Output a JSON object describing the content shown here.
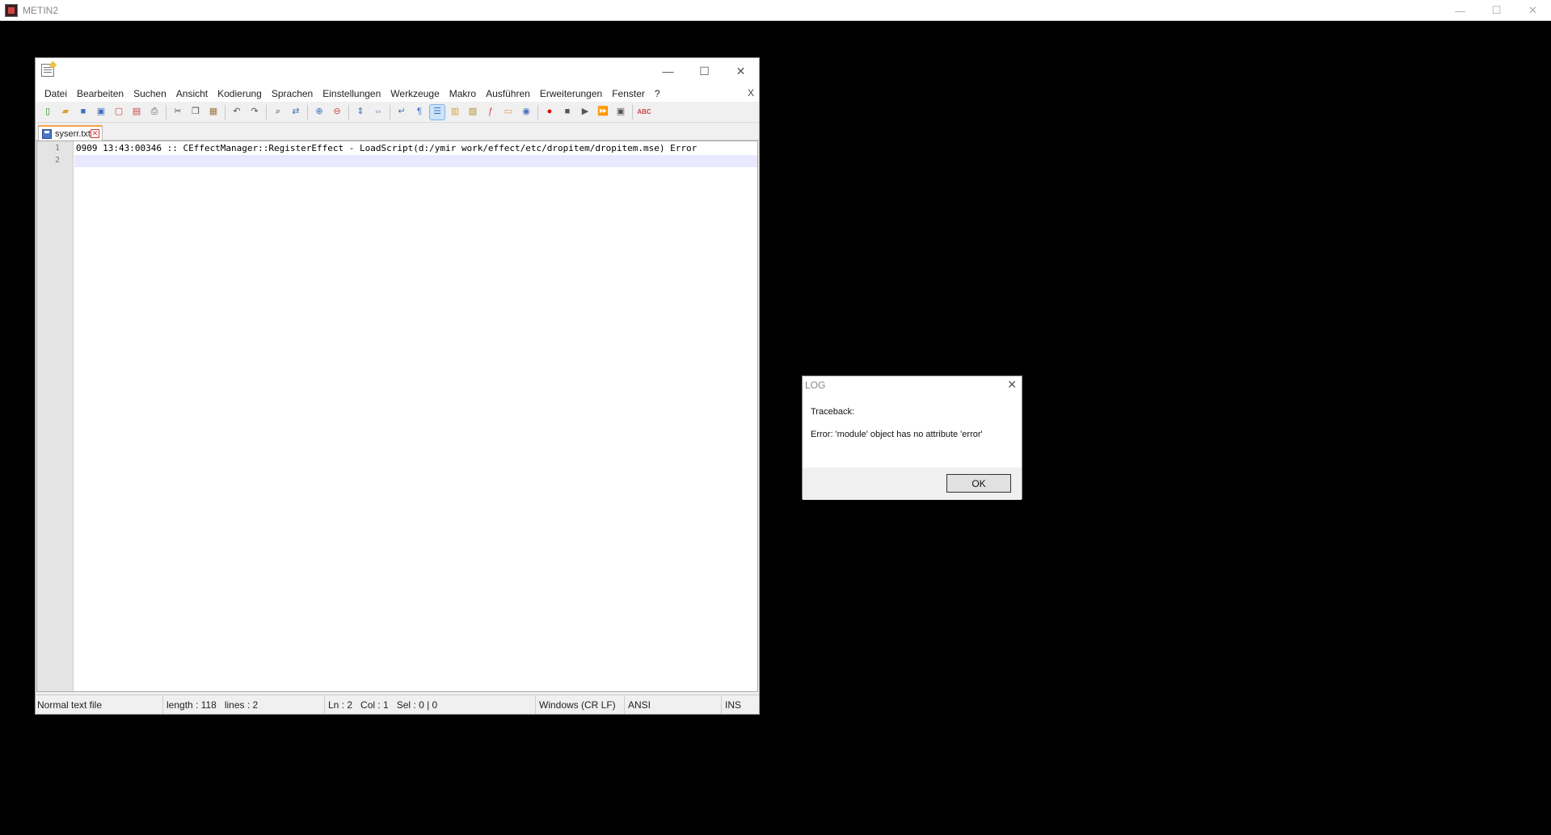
{
  "outer_window": {
    "title": "METIN2",
    "controls": [
      "—",
      "☐",
      "✕"
    ]
  },
  "notepad": {
    "controls": [
      "—",
      "☐",
      "✕"
    ],
    "menu": [
      "Datei",
      "Bearbeiten",
      "Suchen",
      "Ansicht",
      "Kodierung",
      "Sprachen",
      "Einstellungen",
      "Werkzeuge",
      "Makro",
      "Ausführen",
      "Erweiterungen",
      "Fenster",
      "?"
    ],
    "menu_close": "X",
    "tab": {
      "label": "syserr.txt",
      "close": "✕"
    },
    "lines": [
      {
        "num": "1",
        "text": "0909 13:43:00346 :: CEffectManager::RegisterEffect - LoadScript(d:/ymir work/effect/etc/dropitem/dropitem.mse) Error"
      },
      {
        "num": "2",
        "text": ""
      }
    ],
    "status": {
      "file_type": "Normal text file",
      "length": "length : 118",
      "lines": "lines : 2",
      "ln": "Ln : 2",
      "col": "Col : 1",
      "sel": "Sel : 0 | 0",
      "eol": "Windows (CR LF)",
      "encoding": "ANSI",
      "mode": "INS"
    }
  },
  "log_dialog": {
    "title": "LOG",
    "close": "✕",
    "line1": "Traceback:",
    "line2": "Error: 'module' object has no attribute 'error'",
    "ok_label": "OK"
  }
}
